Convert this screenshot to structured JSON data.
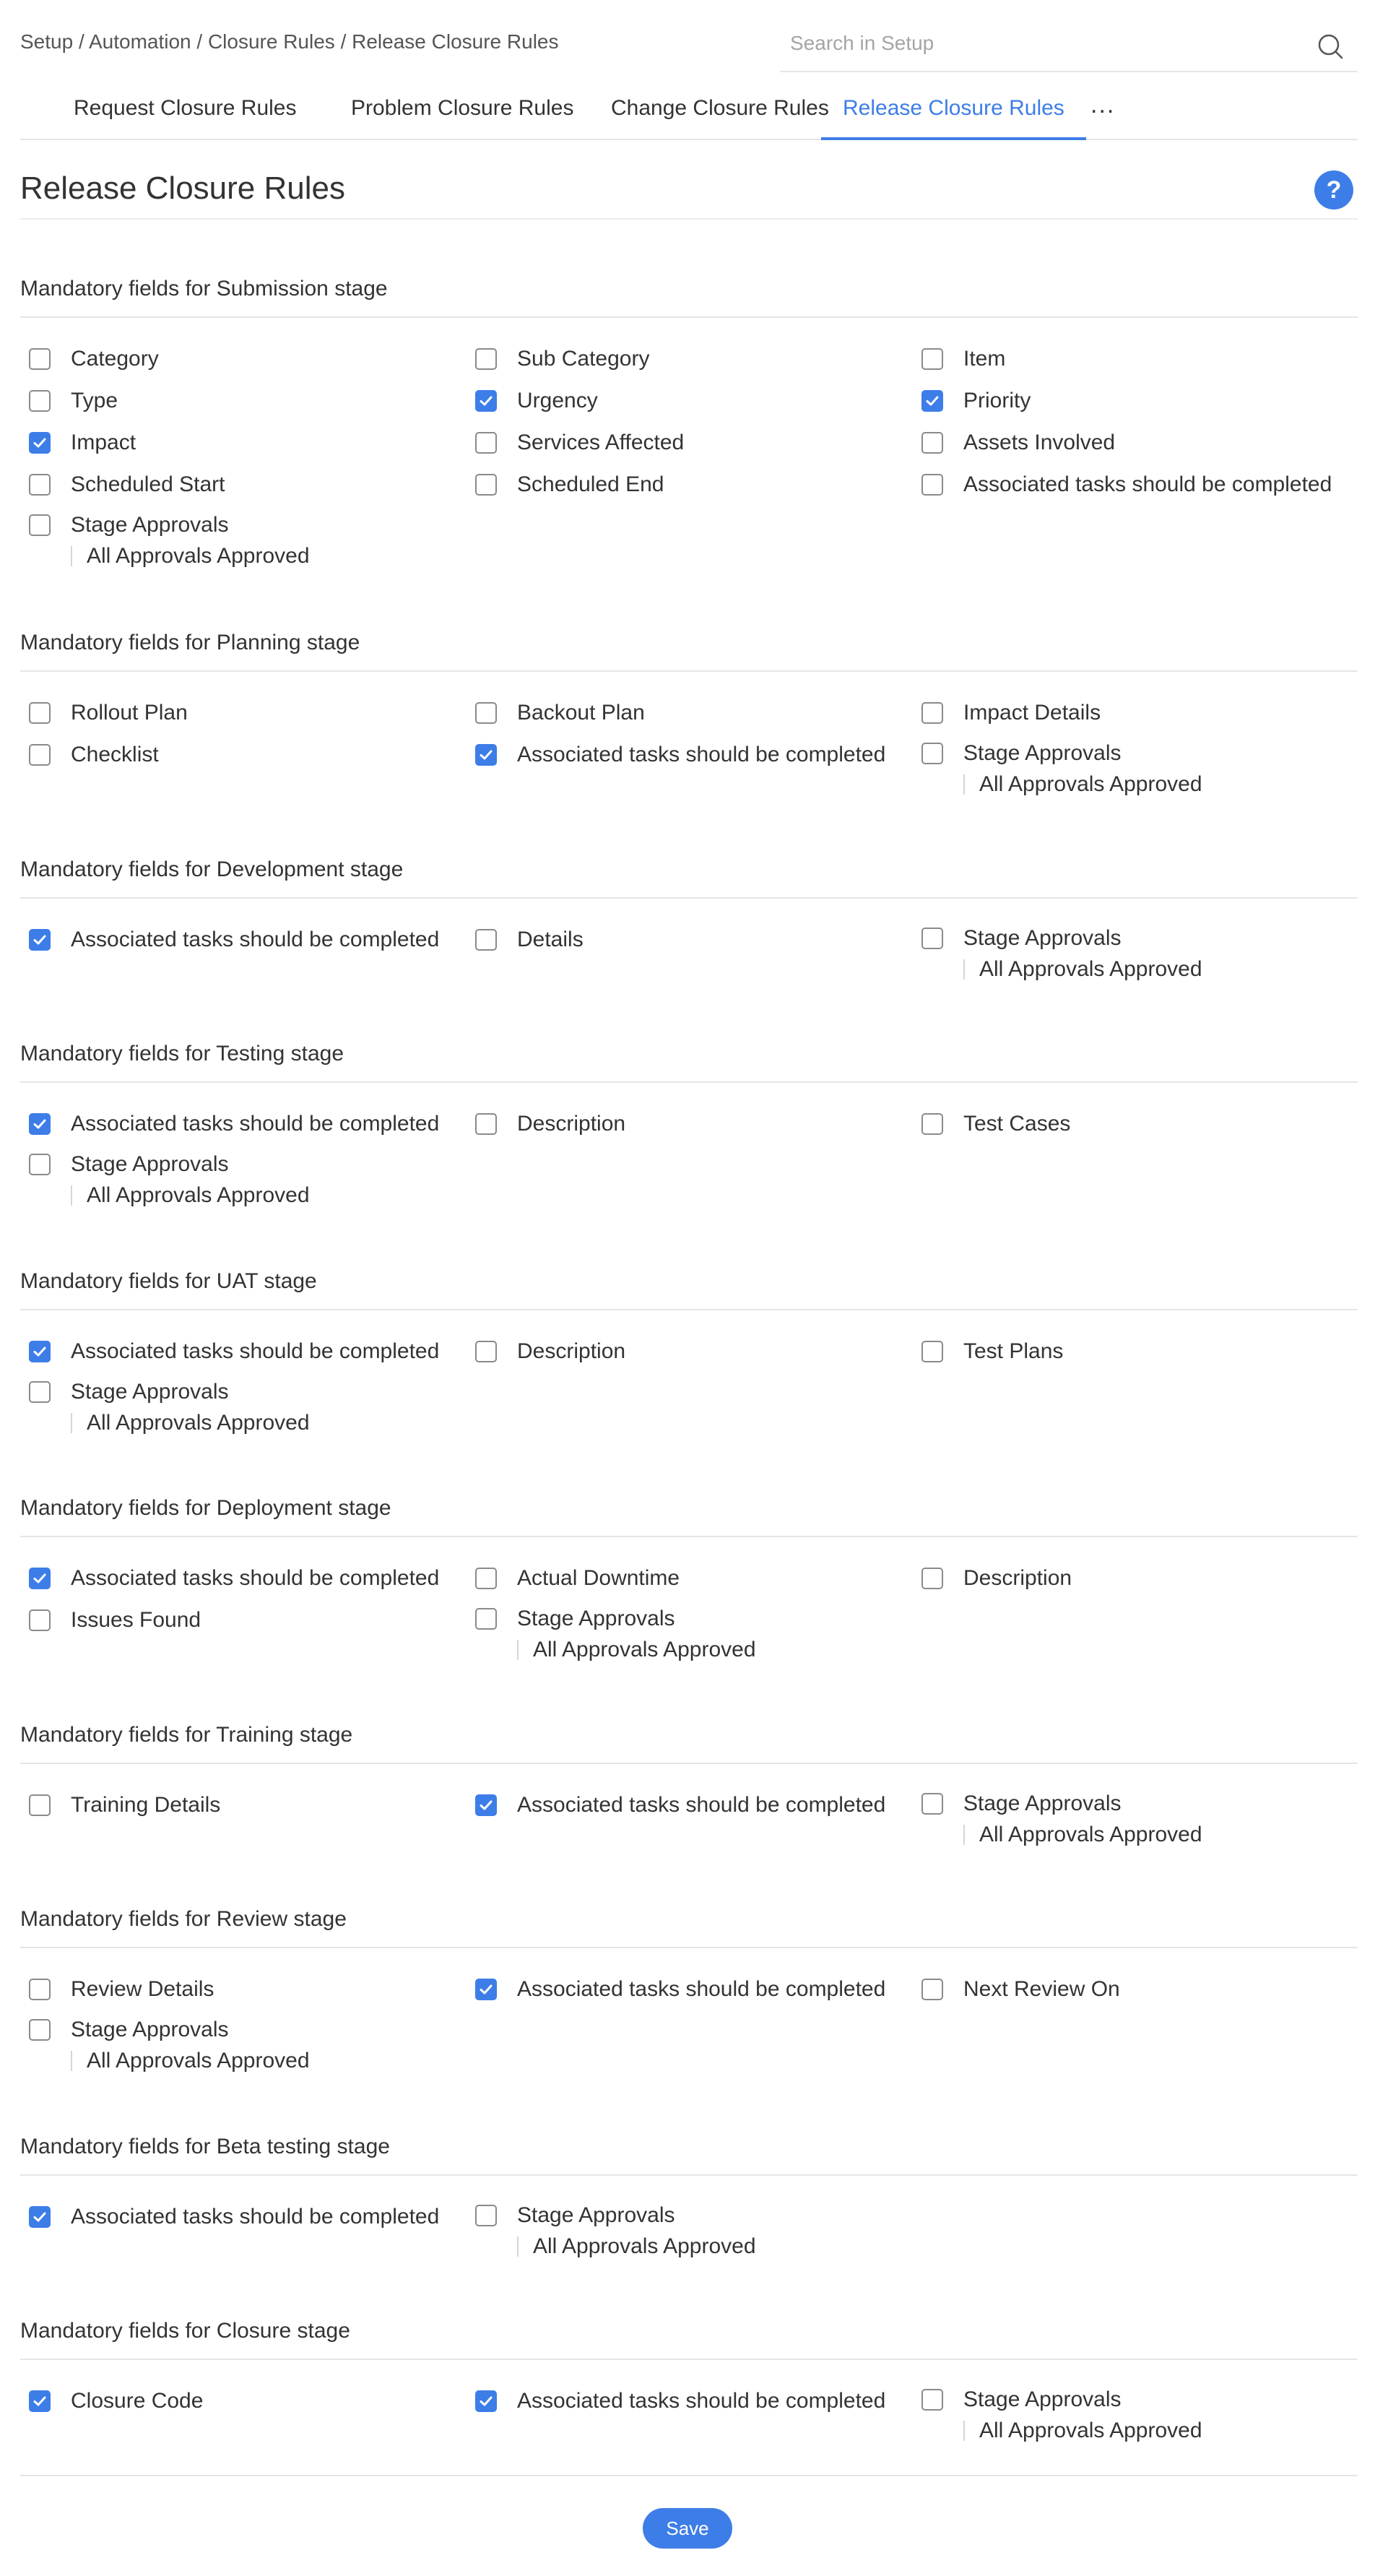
{
  "breadcrumb": "Setup / Automation / Closure Rules / Release Closure Rules",
  "search": {
    "placeholder": "Search in Setup"
  },
  "tabs": [
    {
      "label": "Request Closure Rules",
      "active": false
    },
    {
      "label": "Problem Closure Rules",
      "active": false
    },
    {
      "label": "Change Closure Rules",
      "active": false
    },
    {
      "label": "Release Closure Rules",
      "active": true
    }
  ],
  "more_tabs_label": "...",
  "page_title": "Release Closure Rules",
  "help_label": "?",
  "colors": {
    "accent": "#3d7de8",
    "text": "#333333",
    "rule": "#e5e5e5"
  },
  "icons": {
    "search": "search-icon",
    "help": "help-icon",
    "check": "checkmark-icon"
  },
  "sections": [
    {
      "title": "Mandatory fields for Submission stage",
      "items": [
        {
          "label": "Category",
          "checked": false
        },
        {
          "label": "Sub Category",
          "checked": false
        },
        {
          "label": "Item",
          "checked": false
        },
        {
          "label": "Type",
          "checked": false
        },
        {
          "label": "Urgency",
          "checked": true
        },
        {
          "label": "Priority",
          "checked": true
        },
        {
          "label": "Impact",
          "checked": true
        },
        {
          "label": "Services Affected",
          "checked": false
        },
        {
          "label": "Assets Involved",
          "checked": false
        },
        {
          "label": "Scheduled Start",
          "checked": false
        },
        {
          "label": "Scheduled End",
          "checked": false
        },
        {
          "label": "Associated tasks should be completed",
          "checked": false
        },
        {
          "label": "Stage Approvals",
          "checked": false,
          "sub": "All Approvals Approved"
        }
      ]
    },
    {
      "title": "Mandatory fields for Planning stage",
      "items": [
        {
          "label": "Rollout Plan",
          "checked": false
        },
        {
          "label": "Backout Plan",
          "checked": false
        },
        {
          "label": "Impact Details",
          "checked": false
        },
        {
          "label": "Checklist",
          "checked": false
        },
        {
          "label": "Associated tasks should be completed",
          "checked": true
        },
        {
          "label": "Stage Approvals",
          "checked": false,
          "sub": "All Approvals Approved"
        }
      ]
    },
    {
      "title": "Mandatory fields for Development stage",
      "items": [
        {
          "label": "Associated tasks should be completed",
          "checked": true
        },
        {
          "label": "Details",
          "checked": false
        },
        {
          "label": "Stage Approvals",
          "checked": false,
          "sub": "All Approvals Approved"
        }
      ]
    },
    {
      "title": "Mandatory fields for Testing stage",
      "items": [
        {
          "label": "Associated tasks should be completed",
          "checked": true
        },
        {
          "label": "Description",
          "checked": false
        },
        {
          "label": "Test Cases",
          "checked": false
        },
        {
          "label": "Stage Approvals",
          "checked": false,
          "sub": "All Approvals Approved"
        }
      ]
    },
    {
      "title": "Mandatory fields for UAT stage",
      "items": [
        {
          "label": "Associated tasks should be completed",
          "checked": true
        },
        {
          "label": "Description",
          "checked": false
        },
        {
          "label": "Test Plans",
          "checked": false
        },
        {
          "label": "Stage Approvals",
          "checked": false,
          "sub": "All Approvals Approved"
        }
      ]
    },
    {
      "title": "Mandatory fields for Deployment stage",
      "items": [
        {
          "label": "Associated tasks should be completed",
          "checked": true
        },
        {
          "label": "Actual Downtime",
          "checked": false
        },
        {
          "label": "Description",
          "checked": false
        },
        {
          "label": "Issues Found",
          "checked": false
        },
        {
          "label": "Stage Approvals",
          "checked": false,
          "sub": "All Approvals Approved"
        }
      ]
    },
    {
      "title": "Mandatory fields for Training stage",
      "items": [
        {
          "label": "Training Details",
          "checked": false
        },
        {
          "label": "Associated tasks should be completed",
          "checked": true
        },
        {
          "label": "Stage Approvals",
          "checked": false,
          "sub": "All Approvals Approved"
        }
      ]
    },
    {
      "title": "Mandatory fields for Review stage",
      "items": [
        {
          "label": "Review Details",
          "checked": false
        },
        {
          "label": "Associated tasks should be completed",
          "checked": true
        },
        {
          "label": "Next Review On",
          "checked": false
        },
        {
          "label": "Stage Approvals",
          "checked": false,
          "sub": "All Approvals Approved"
        }
      ]
    },
    {
      "title": "Mandatory fields for Beta testing stage",
      "items": [
        {
          "label": "Associated tasks should be completed",
          "checked": true
        },
        {
          "label": "Stage Approvals",
          "checked": false,
          "sub": "All Approvals Approved"
        }
      ]
    },
    {
      "title": "Mandatory fields for Closure stage",
      "items": [
        {
          "label": "Closure Code",
          "checked": true
        },
        {
          "label": "Associated tasks should be completed",
          "checked": true
        },
        {
          "label": "Stage Approvals",
          "checked": false,
          "sub": "All Approvals Approved"
        }
      ]
    }
  ],
  "save_label": "Save"
}
